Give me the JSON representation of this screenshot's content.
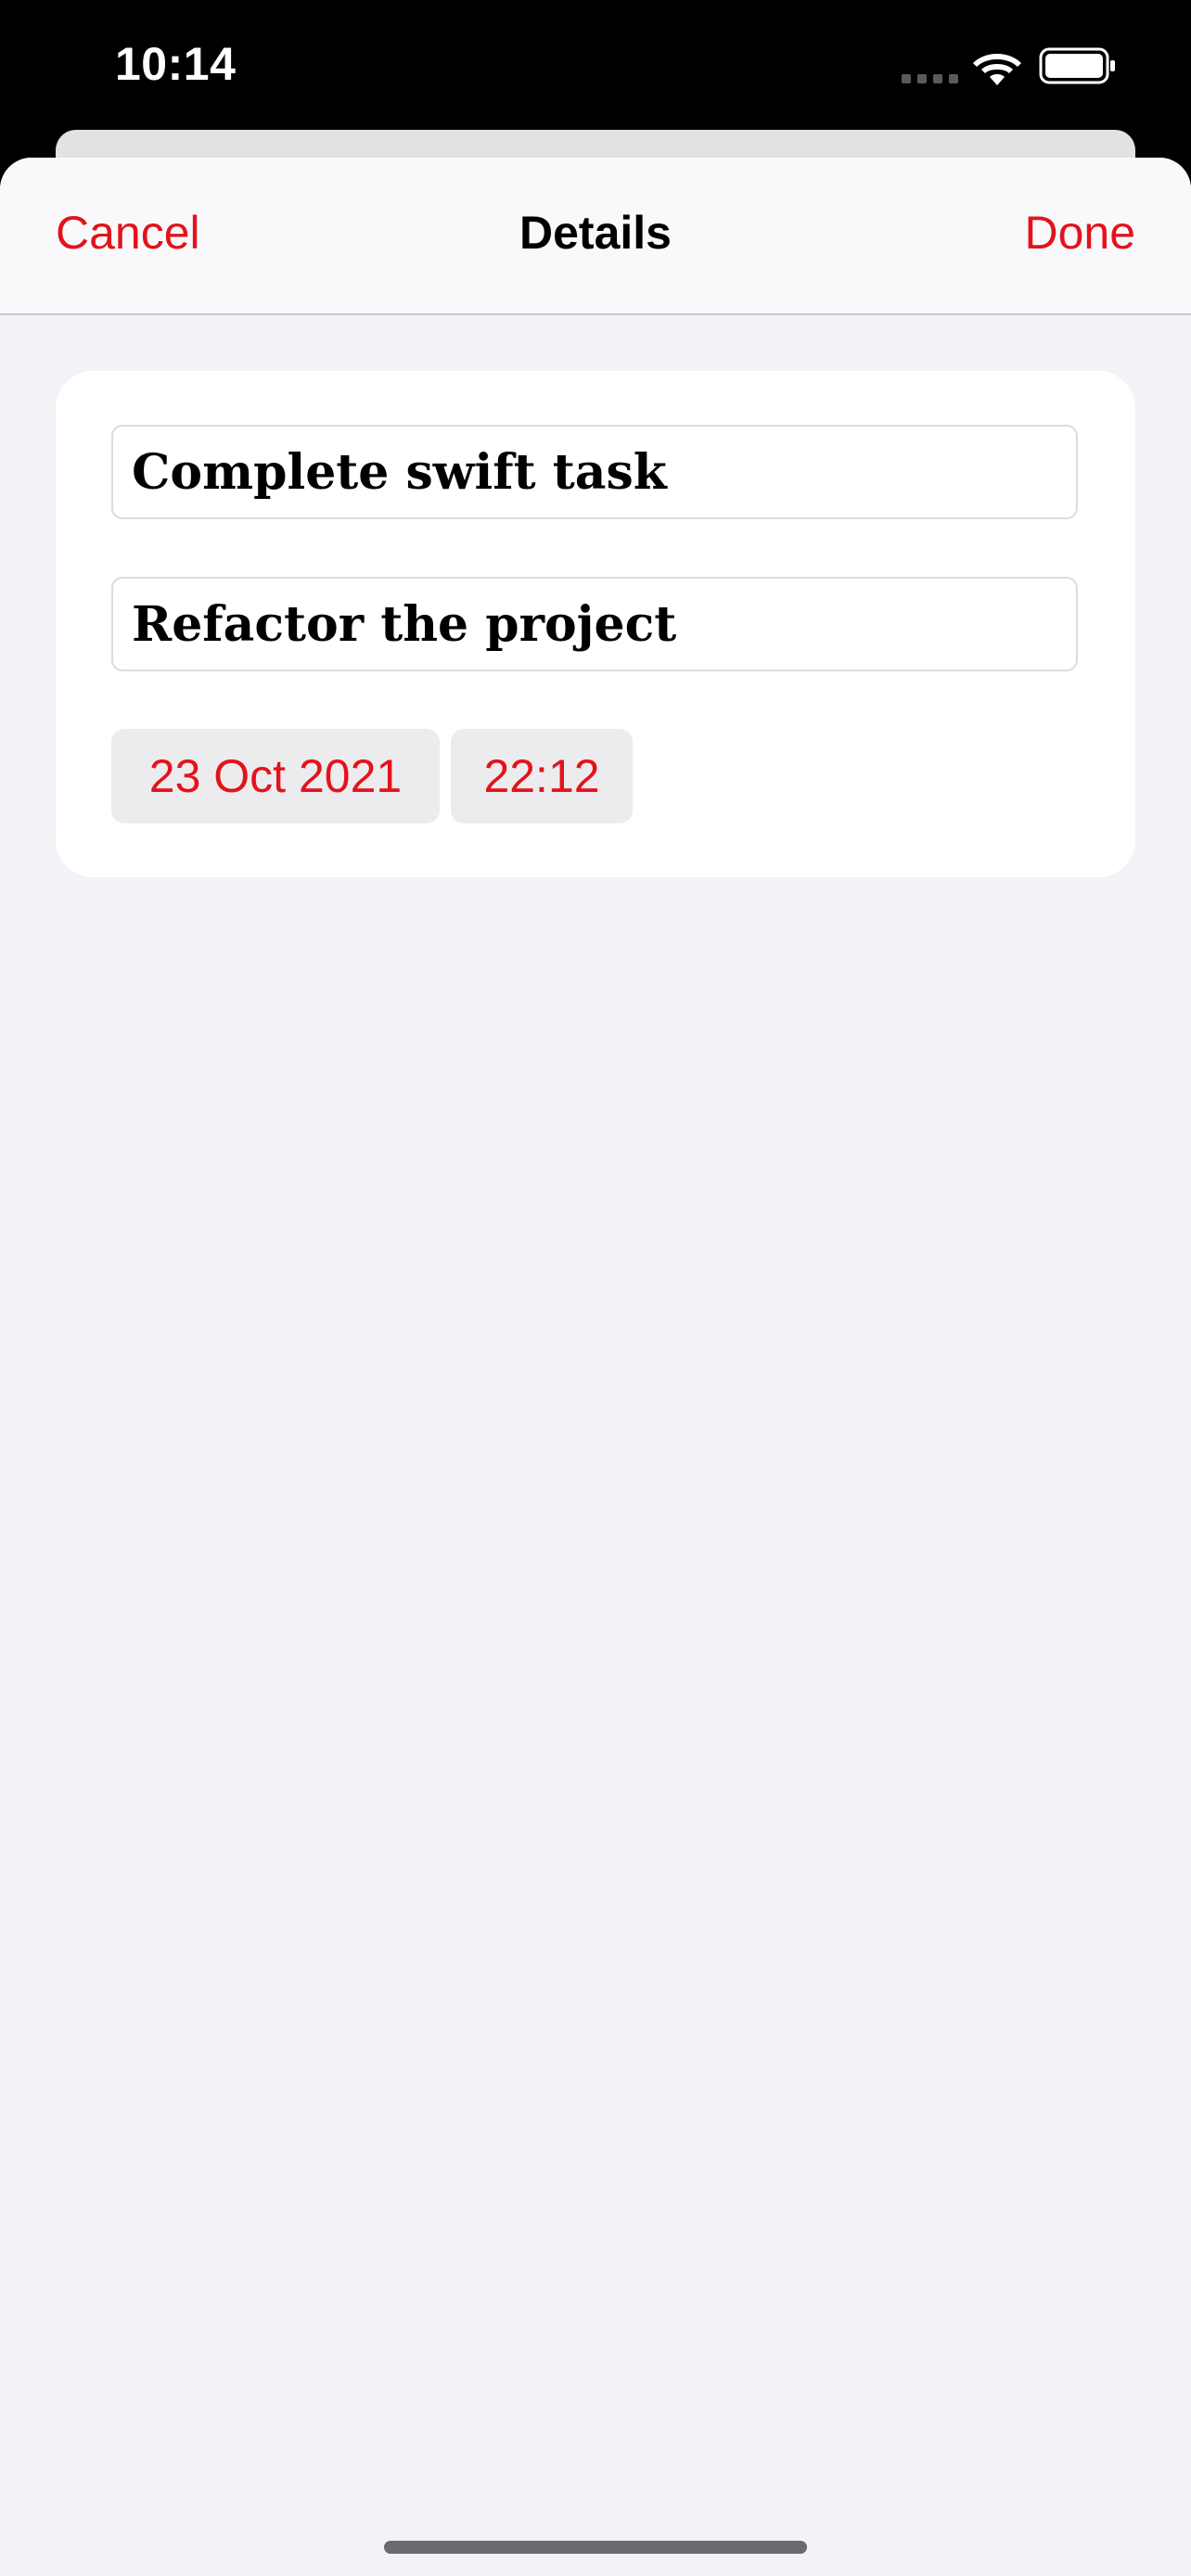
{
  "status_bar": {
    "time": "10:14"
  },
  "nav": {
    "cancel_label": "Cancel",
    "title": "Details",
    "done_label": "Done"
  },
  "form": {
    "title_value": "Complete swift task",
    "notes_value": "Refactor the project",
    "date_label": "23 Oct 2021",
    "time_label": "22:12"
  },
  "colors": {
    "accent": "#e3131b",
    "background": "#f2f2f7",
    "card": "#ffffff",
    "chip": "#ececee"
  },
  "icons": {
    "signal": "cellular-signal-icon",
    "wifi": "wifi-icon",
    "battery": "battery-icon"
  }
}
